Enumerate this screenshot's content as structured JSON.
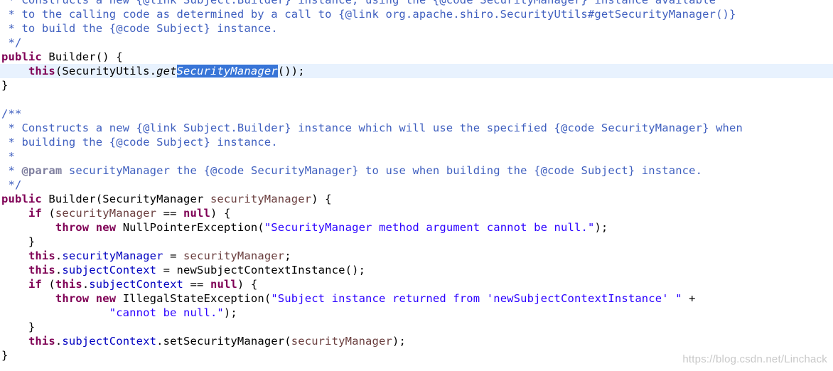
{
  "editor": {
    "language": "java",
    "current_line_index": 5,
    "lines": [
      [
        {
          "t": " * Constructs a new {@link Subject.Builder} instance, using the {@code SecurityManager} instance available",
          "c": "comment"
        }
      ],
      [
        {
          "t": " * to the calling code as determined by a call to {@link org.apache.shiro.SecurityUtils#getSecurityManager()}",
          "c": "comment"
        }
      ],
      [
        {
          "t": " * to build the {@code Subject} instance.",
          "c": "comment"
        }
      ],
      [
        {
          "t": " */",
          "c": "comment"
        }
      ],
      [
        {
          "t": "public",
          "c": "kw"
        },
        {
          "t": " Builder() {",
          "c": "plain"
        }
      ],
      [
        {
          "t": "    ",
          "c": "plain"
        },
        {
          "t": "this",
          "c": "kw"
        },
        {
          "t": "(SecurityUtils.",
          "c": "plain"
        },
        {
          "t": "get",
          "c": "ital"
        },
        {
          "t": "SecurityManager",
          "c": "sel"
        },
        {
          "t": "());",
          "c": "plain"
        }
      ],
      [
        {
          "t": "}",
          "c": "plain"
        }
      ],
      [],
      [
        {
          "t": "/**",
          "c": "comment"
        }
      ],
      [
        {
          "t": " * Constructs a new {@link Subject.Builder} instance which will use the specified {@code SecurityManager} when",
          "c": "comment"
        }
      ],
      [
        {
          "t": " * building the {@code Subject} instance.",
          "c": "comment"
        }
      ],
      [
        {
          "t": " *",
          "c": "comment"
        }
      ],
      [
        {
          "t": " * ",
          "c": "comment"
        },
        {
          "t": "@param",
          "c": "tag"
        },
        {
          "t": " securityManager the {@code SecurityManager} to use when building the {@code Subject} instance.",
          "c": "comment"
        }
      ],
      [
        {
          "t": " */",
          "c": "comment"
        }
      ],
      [
        {
          "t": "public",
          "c": "kw"
        },
        {
          "t": " Builder(SecurityManager ",
          "c": "plain"
        },
        {
          "t": "securityManager",
          "c": "param"
        },
        {
          "t": ") {",
          "c": "plain"
        }
      ],
      [
        {
          "t": "    ",
          "c": "plain"
        },
        {
          "t": "if",
          "c": "kw"
        },
        {
          "t": " (",
          "c": "plain"
        },
        {
          "t": "securityManager",
          "c": "param"
        },
        {
          "t": " == ",
          "c": "plain"
        },
        {
          "t": "null",
          "c": "kw"
        },
        {
          "t": ") {",
          "c": "plain"
        }
      ],
      [
        {
          "t": "        ",
          "c": "plain"
        },
        {
          "t": "throw",
          "c": "kw"
        },
        {
          "t": " ",
          "c": "plain"
        },
        {
          "t": "new",
          "c": "kw"
        },
        {
          "t": " NullPointerException(",
          "c": "plain"
        },
        {
          "t": "\"SecurityManager method argument cannot be null.\"",
          "c": "str"
        },
        {
          "t": ");",
          "c": "plain"
        }
      ],
      [
        {
          "t": "    }",
          "c": "plain"
        }
      ],
      [
        {
          "t": "    ",
          "c": "plain"
        },
        {
          "t": "this",
          "c": "kw"
        },
        {
          "t": ".",
          "c": "plain"
        },
        {
          "t": "securityManager",
          "c": "field"
        },
        {
          "t": " = ",
          "c": "plain"
        },
        {
          "t": "securityManager",
          "c": "param"
        },
        {
          "t": ";",
          "c": "plain"
        }
      ],
      [
        {
          "t": "    ",
          "c": "plain"
        },
        {
          "t": "this",
          "c": "kw"
        },
        {
          "t": ".",
          "c": "plain"
        },
        {
          "t": "subjectContext",
          "c": "field"
        },
        {
          "t": " = newSubjectContextInstance();",
          "c": "plain"
        }
      ],
      [
        {
          "t": "    ",
          "c": "plain"
        },
        {
          "t": "if",
          "c": "kw"
        },
        {
          "t": " (",
          "c": "plain"
        },
        {
          "t": "this",
          "c": "kw"
        },
        {
          "t": ".",
          "c": "plain"
        },
        {
          "t": "subjectContext",
          "c": "field"
        },
        {
          "t": " == ",
          "c": "plain"
        },
        {
          "t": "null",
          "c": "kw"
        },
        {
          "t": ") {",
          "c": "plain"
        }
      ],
      [
        {
          "t": "        ",
          "c": "plain"
        },
        {
          "t": "throw",
          "c": "kw"
        },
        {
          "t": " ",
          "c": "plain"
        },
        {
          "t": "new",
          "c": "kw"
        },
        {
          "t": " IllegalStateException(",
          "c": "plain"
        },
        {
          "t": "\"Subject instance returned from 'newSubjectContextInstance' \"",
          "c": "str"
        },
        {
          "t": " +",
          "c": "plain"
        }
      ],
      [
        {
          "t": "                ",
          "c": "plain"
        },
        {
          "t": "\"cannot be null.\"",
          "c": "str"
        },
        {
          "t": ");",
          "c": "plain"
        }
      ],
      [
        {
          "t": "    }",
          "c": "plain"
        }
      ],
      [
        {
          "t": "    ",
          "c": "plain"
        },
        {
          "t": "this",
          "c": "kw"
        },
        {
          "t": ".",
          "c": "plain"
        },
        {
          "t": "subjectContext",
          "c": "field"
        },
        {
          "t": ".setSecurityManager(",
          "c": "plain"
        },
        {
          "t": "securityManager",
          "c": "param"
        },
        {
          "t": ");",
          "c": "plain"
        }
      ],
      [
        {
          "t": "}",
          "c": "plain"
        }
      ]
    ]
  },
  "watermark": "https://blog.csdn.net/Linchack",
  "colors": {
    "comment": "#3f5fbf",
    "javadoc_tag": "#7f7f9f",
    "keyword": "#7f0055",
    "field": "#0000c0",
    "parameter": "#6a3e3e",
    "string": "#2a00ff",
    "selection": "#3875d7",
    "current_line": "#e8f2fe"
  }
}
